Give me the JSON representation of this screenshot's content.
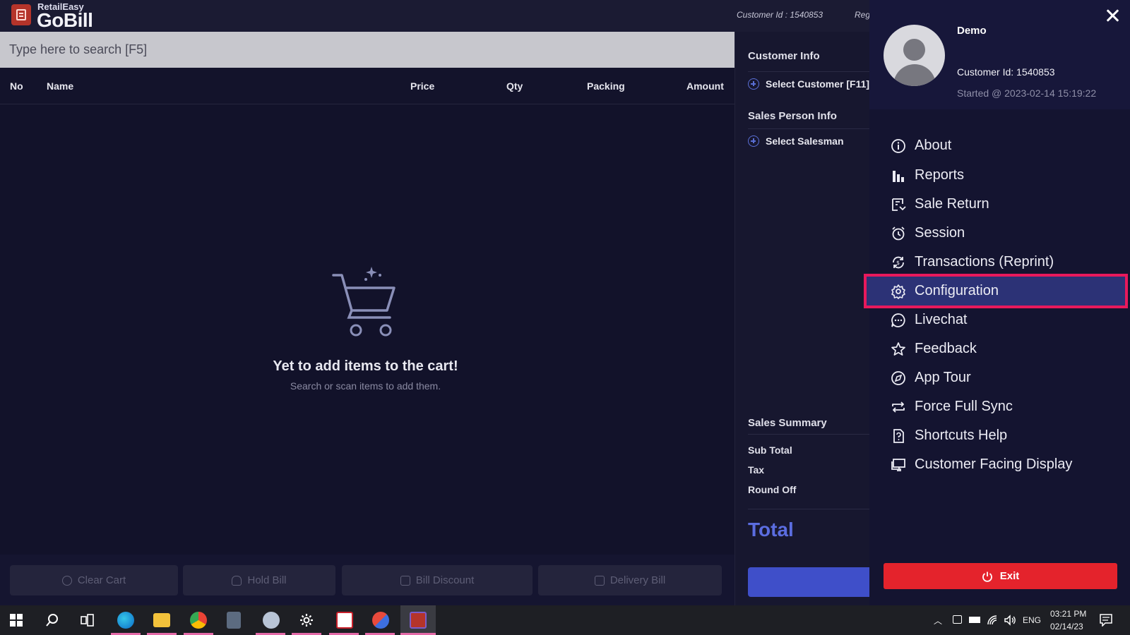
{
  "app": {
    "brand_small": "RetailEasy",
    "brand_big": "GoBill",
    "customer_id_label": "Customer Id : 1540853",
    "reg_label": "Reg"
  },
  "search": {
    "placeholder": "Type here to search [F5]"
  },
  "table": {
    "columns": [
      "No",
      "Name",
      "Price",
      "Qty",
      "Packing",
      "Amount"
    ]
  },
  "empty_cart": {
    "title": "Yet to add items to the cart!",
    "subtitle": "Search or scan items to add them."
  },
  "bottom_buttons": {
    "clear_cart": "Clear Cart",
    "hold_bill": "Hold Bill",
    "bill_discount": "Bill Discount",
    "delivery_bill": "Delivery Bill"
  },
  "right_panel": {
    "customer_info": "Customer Info",
    "select_customer": "Select Customer [F11]",
    "sales_person_info": "Sales Person Info",
    "select_salesman": "Select Salesman",
    "sales_summary": "Sales Summary",
    "sub_total": "Sub Total",
    "tax": "Tax",
    "round_off": "Round Off",
    "total": "Total"
  },
  "drawer": {
    "user_name": "Demo",
    "customer_id": "Customer Id: 1540853",
    "started": "Started @ 2023-02-14 15:19:22",
    "menu": [
      {
        "label": "About",
        "icon": "info-icon"
      },
      {
        "label": "Reports",
        "icon": "bar-chart-icon"
      },
      {
        "label": "Sale Return",
        "icon": "receipt-return-icon"
      },
      {
        "label": "Session",
        "icon": "alarm-clock-icon"
      },
      {
        "label": "Transactions (Reprint)",
        "icon": "currency-refresh-icon"
      },
      {
        "label": "Configuration",
        "icon": "gear-icon"
      },
      {
        "label": "Livechat",
        "icon": "chat-bubble-icon"
      },
      {
        "label": "Feedback",
        "icon": "star-icon"
      },
      {
        "label": "App Tour",
        "icon": "compass-icon"
      },
      {
        "label": "Force Full Sync",
        "icon": "sync-icon"
      },
      {
        "label": "Shortcuts Help",
        "icon": "help-page-icon"
      },
      {
        "label": "Customer Facing Display",
        "icon": "monitor-icon"
      }
    ],
    "exit": "Exit"
  },
  "taskbar": {
    "time": "03:21 PM",
    "date": "02/14/23",
    "lang": "ENG"
  },
  "colors": {
    "highlight": "#e8195c",
    "active_bg": "#2c3276",
    "exit": "#e4232c",
    "accent": "#5b6de0"
  }
}
